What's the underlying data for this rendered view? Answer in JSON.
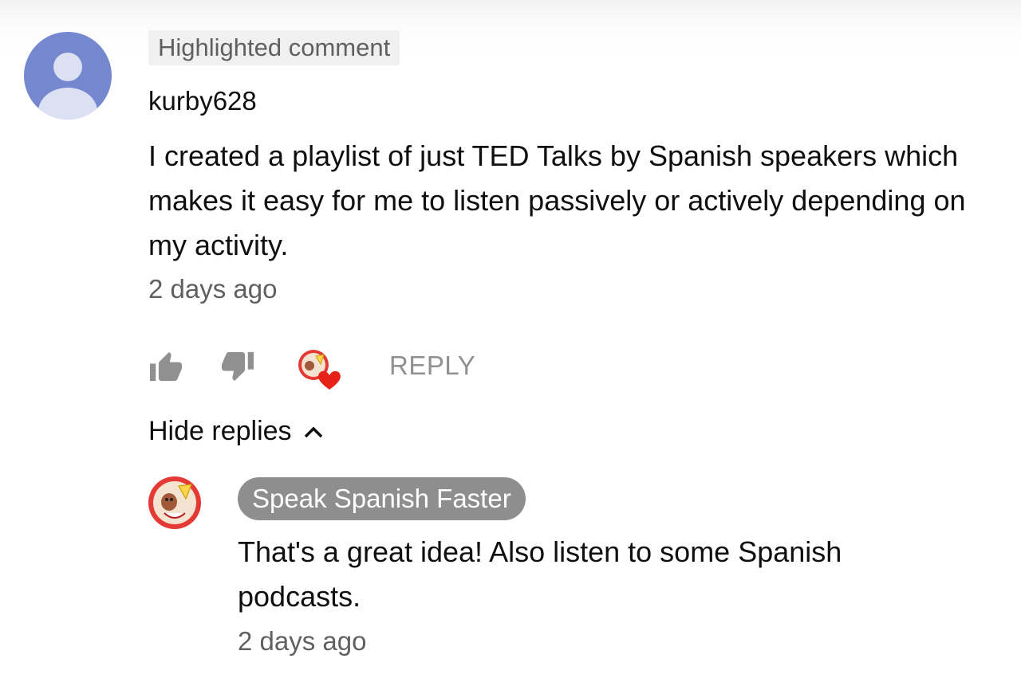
{
  "comment": {
    "highlight_label": "Highlighted comment",
    "author": "kurby628",
    "text": "I created a playlist of just TED Talks by Spanish speakers which makes it easy for me to listen passively or actively depending on my activity.",
    "timestamp": "2 days ago",
    "avatar_color": "#7588cf"
  },
  "actions": {
    "like_icon": "thumbs-up-icon",
    "dislike_icon": "thumbs-down-icon",
    "creator_heart_icon": "creator-heart-icon",
    "reply_label": "REPLY"
  },
  "replies_toggle": {
    "label": "Hide replies",
    "icon": "chevron-up-icon"
  },
  "reply": {
    "channel_name": "Speak Spanish Faster",
    "text": "That's a great idea! Also listen to some Spanish podcasts.",
    "timestamp": "2 days ago",
    "avatar_color": "#e53935",
    "heart_color": "#e62117"
  }
}
